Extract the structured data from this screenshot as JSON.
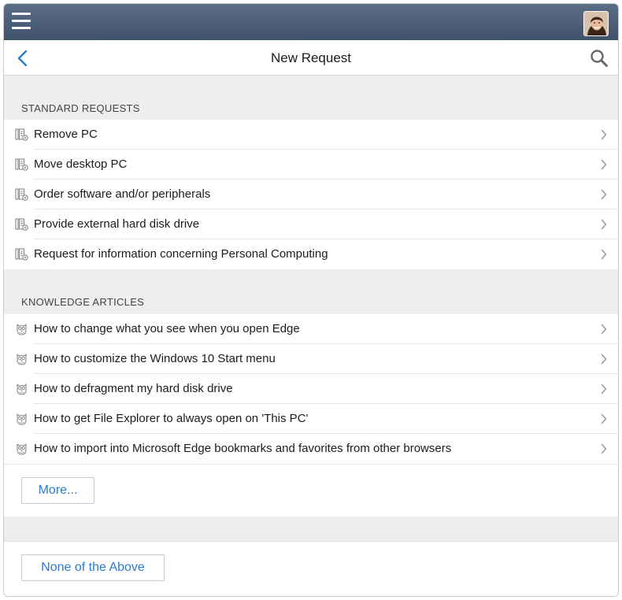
{
  "header": {
    "title": "New Request",
    "menu_icon": "hamburger-icon",
    "back_icon": "chevron-left-icon",
    "search_icon": "search-icon",
    "avatar": "user-avatar"
  },
  "standard_requests": {
    "title": "STANDARD REQUESTS",
    "icon": "request-icon",
    "items": [
      {
        "label": "Remove PC"
      },
      {
        "label": "Move desktop PC"
      },
      {
        "label": "Order software and/or peripherals"
      },
      {
        "label": "Provide external hard disk drive"
      },
      {
        "label": "Request for information concerning Personal Computing"
      }
    ]
  },
  "knowledge_articles": {
    "title": "KNOWLEDGE ARTICLES",
    "icon": "owl-icon",
    "items": [
      {
        "label": "How to change what you see when you open Edge"
      },
      {
        "label": "How to customize the Windows 10 Start menu"
      },
      {
        "label": "How to defragment my hard disk drive"
      },
      {
        "label": "How to get File Explorer to always open on 'This PC'"
      },
      {
        "label": "How to import into Microsoft Edge bookmarks and favorites from other browsers"
      }
    ],
    "more_label": "More..."
  },
  "footer": {
    "none_label": "None of the Above"
  },
  "colors": {
    "topbar": "#4a5d76",
    "accent": "#2b7bd4",
    "section_bg": "#eeeef0"
  }
}
